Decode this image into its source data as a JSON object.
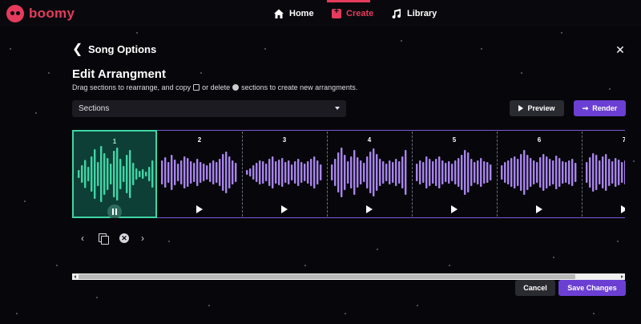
{
  "app": {
    "name": "boomy",
    "brand_color": "#e53b5c"
  },
  "nav": {
    "items": [
      {
        "label": "Home",
        "icon": "home-icon"
      },
      {
        "label": "Create",
        "icon": "create-icon",
        "active": true
      },
      {
        "label": "Library",
        "icon": "music-note-icon"
      }
    ]
  },
  "header": {
    "back_icon": "chevron-left-icon",
    "title": "Song Options",
    "close_icon": "close-icon"
  },
  "editor": {
    "title": "Edit Arrangment",
    "description_part1": "Drag sections to rearrange, and copy",
    "description_part2": "or delete",
    "description_part3": "sections to create new arrangments.",
    "sections_select": {
      "value": "Sections"
    },
    "preview_label": "Preview",
    "render_label": "Render",
    "accent_color": "#6b3fd3",
    "selected_color": "#3fd5a4"
  },
  "timeline": {
    "sections": [
      {
        "number": "1",
        "selected": true,
        "state": "playing"
      },
      {
        "number": "2",
        "selected": false,
        "state": "paused"
      },
      {
        "number": "3",
        "selected": false,
        "state": "paused"
      },
      {
        "number": "4",
        "selected": false,
        "state": "paused"
      },
      {
        "number": "5",
        "selected": false,
        "state": "paused"
      },
      {
        "number": "6",
        "selected": false,
        "state": "paused"
      },
      {
        "number": "7",
        "selected": false,
        "state": "paused"
      }
    ]
  },
  "footer": {
    "cancel_label": "Cancel",
    "save_label": "Save Changes"
  }
}
